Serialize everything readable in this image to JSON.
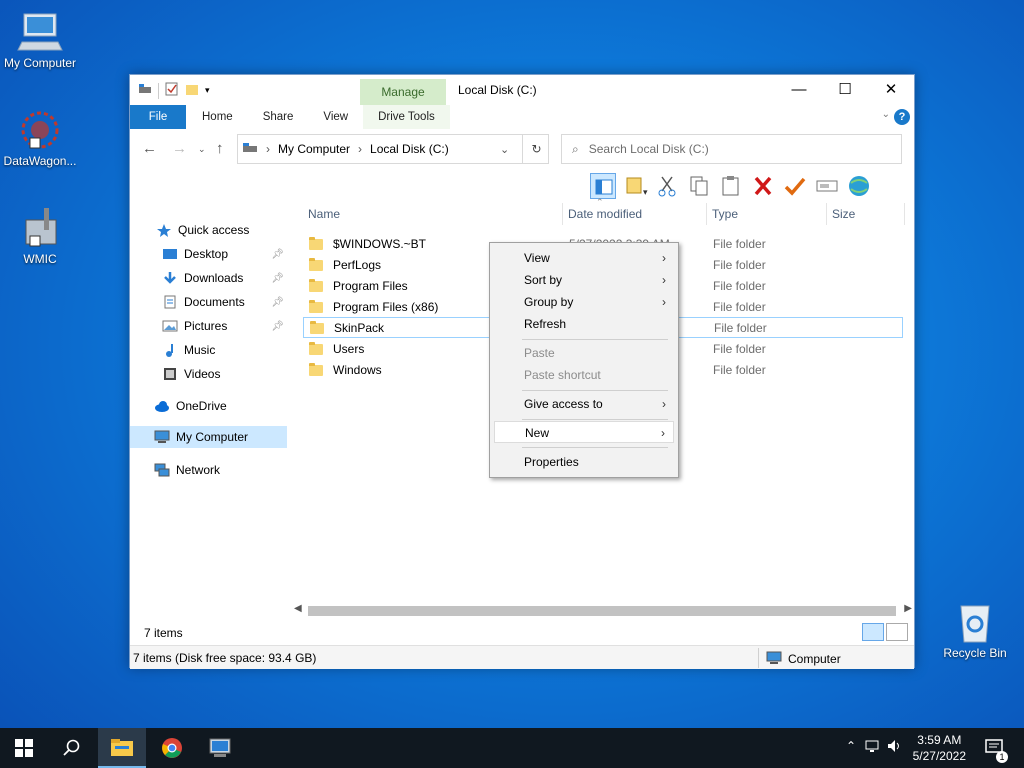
{
  "desktop": {
    "icons": [
      {
        "label": "My Computer"
      },
      {
        "label": "DataWagon..."
      },
      {
        "label": "WMIC"
      },
      {
        "label": "Recycle Bin"
      }
    ]
  },
  "window": {
    "title": "Local Disk (C:)",
    "contextual_tab": "Manage",
    "controls": {
      "minimize": "—",
      "maximize": "☐",
      "close": "✕"
    },
    "ribbon_tabs": [
      "File",
      "Home",
      "Share",
      "View",
      "Drive Tools"
    ],
    "help": "?"
  },
  "address": {
    "breadcrumb": [
      "My Computer",
      "Local Disk (C:)"
    ],
    "search_placeholder": "Search Local Disk (C:)"
  },
  "nav_pane": {
    "items": [
      {
        "label": "Quick access",
        "icon": "star-icon"
      },
      {
        "label": "Desktop",
        "icon": "desktop-icon",
        "pinned": true
      },
      {
        "label": "Downloads",
        "icon": "download-icon",
        "pinned": true
      },
      {
        "label": "Documents",
        "icon": "documents-icon",
        "pinned": true
      },
      {
        "label": "Pictures",
        "icon": "pictures-icon",
        "pinned": true
      },
      {
        "label": "Music",
        "icon": "music-icon"
      },
      {
        "label": "Videos",
        "icon": "videos-icon"
      },
      {
        "label": "OneDrive",
        "icon": "cloud-icon"
      },
      {
        "label": "My Computer",
        "icon": "computer-icon",
        "selected": true
      },
      {
        "label": "Network",
        "icon": "network-icon"
      }
    ]
  },
  "columns": [
    "Name",
    "Date modified",
    "Type",
    "Size"
  ],
  "files": [
    {
      "name": "$WINDOWS.~BT",
      "date": "5/27/2022 3:39 AM",
      "type": "File folder"
    },
    {
      "name": "PerfLogs",
      "date": "",
      "type": "File folder"
    },
    {
      "name": "Program Files",
      "date": "",
      "type": "File folder"
    },
    {
      "name": "Program Files (x86)",
      "date": "",
      "type": "File folder"
    },
    {
      "name": "SkinPack",
      "date": "",
      "type": "File folder"
    },
    {
      "name": "Users",
      "date": "",
      "type": "File folder"
    },
    {
      "name": "Windows",
      "date": "",
      "type": "File folder"
    }
  ],
  "status": {
    "item_count": "7 items",
    "bar_left": "7 items (Disk free space: 93.4 GB)",
    "bar_right": "Computer"
  },
  "context_menu": {
    "items": [
      {
        "label": "View",
        "submenu": true
      },
      {
        "label": "Sort by",
        "submenu": true
      },
      {
        "label": "Group by",
        "submenu": true
      },
      {
        "label": "Refresh"
      },
      {
        "label": "Paste",
        "disabled": true
      },
      {
        "label": "Paste shortcut",
        "disabled": true
      },
      {
        "label": "Give access to",
        "submenu": true
      },
      {
        "label": "New",
        "submenu": true,
        "highlighted": true
      },
      {
        "label": "Properties"
      }
    ]
  },
  "taskbar": {
    "time": "3:59 AM",
    "date": "5/27/2022",
    "notification_count": "1"
  },
  "colors": {
    "accent": "#1979ca",
    "selection": "#cce8ff",
    "desktop": "#0d78d8"
  }
}
